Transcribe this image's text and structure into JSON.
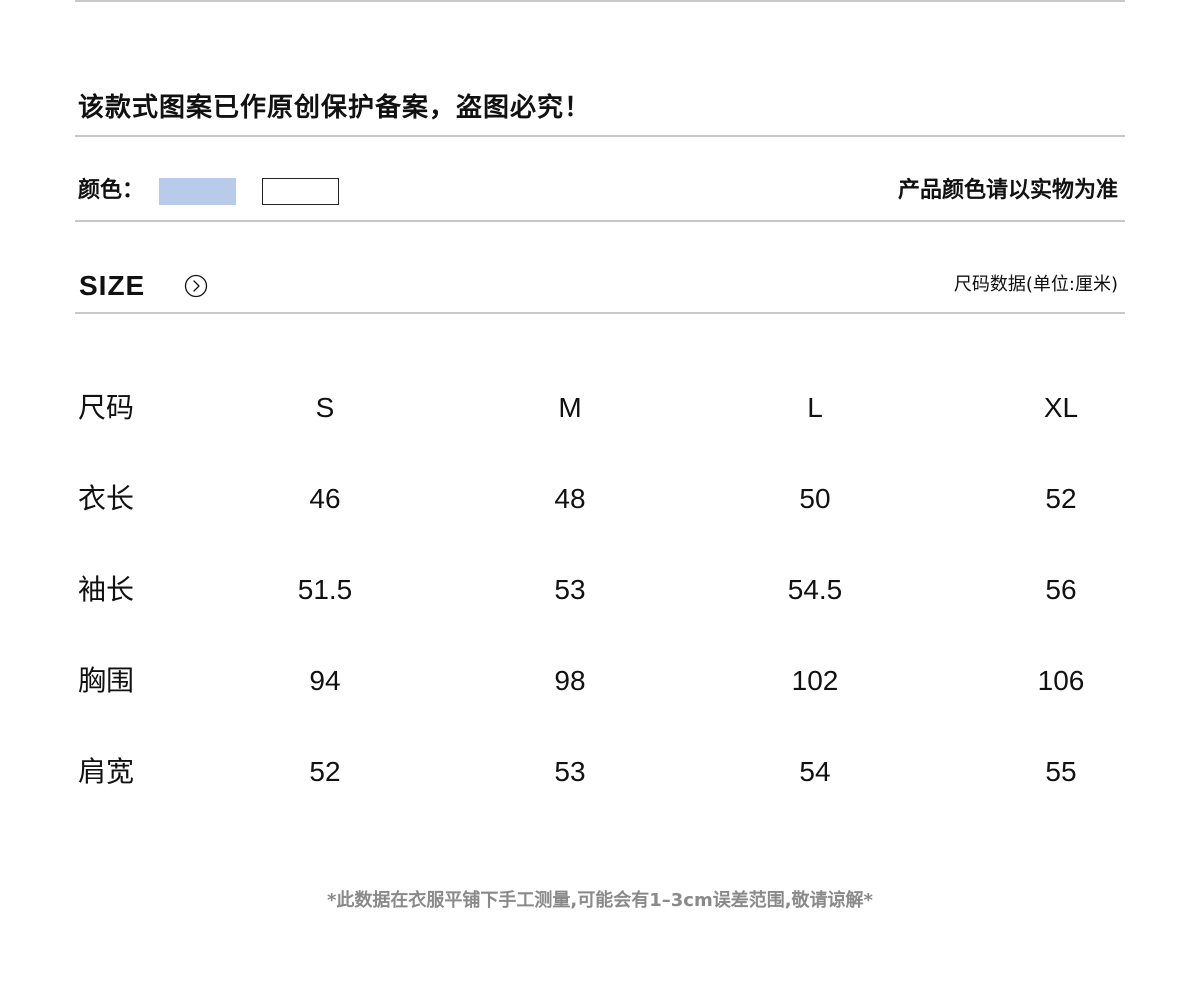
{
  "notice": "该款式图案已作原创保护备案，盗图必究！",
  "color": {
    "label": "颜色：",
    "swatches": [
      "#b9cbea",
      "#ffffff"
    ],
    "note": "产品颜色请以实物为准"
  },
  "size_section": {
    "title": "SIZE",
    "arrow_icon": "chevron-right-circle-icon",
    "unit_note": "尺码数据(单位:厘米)"
  },
  "size_table": {
    "header": {
      "label": "尺码",
      "values": [
        "S",
        "M",
        "L",
        "XL"
      ]
    },
    "rows": [
      {
        "label": "衣长",
        "values": [
          "46",
          "48",
          "50",
          "52"
        ]
      },
      {
        "label": "袖长",
        "values": [
          "51.5",
          "53",
          "54.5",
          "56"
        ]
      },
      {
        "label": "胸围",
        "values": [
          "94",
          "98",
          "102",
          "106"
        ]
      },
      {
        "label": "肩宽",
        "values": [
          "52",
          "53",
          "54",
          "55"
        ]
      }
    ]
  },
  "footnote": "*此数据在衣服平铺下手工测量,可能会有1–3cm误差范围,敬请谅解*"
}
